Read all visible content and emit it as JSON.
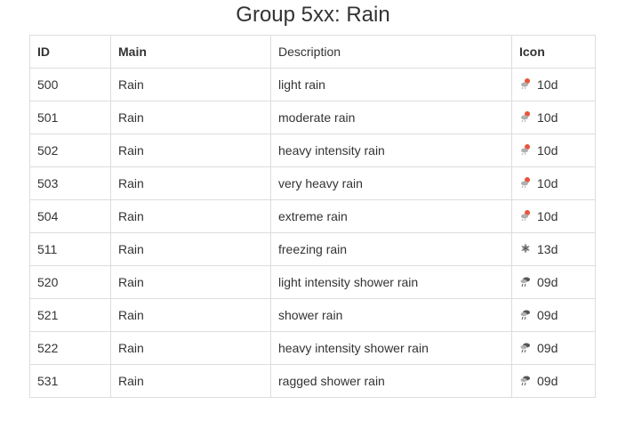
{
  "title": "Group 5xx: Rain",
  "table": {
    "headers": {
      "id": "ID",
      "main": "Main",
      "description": "Description",
      "icon": "Icon"
    },
    "rows": [
      {
        "id": "500",
        "main": "Rain",
        "description": "light rain",
        "icon_code": "10d",
        "icon": "sun-rain-icon"
      },
      {
        "id": "501",
        "main": "Rain",
        "description": "moderate rain",
        "icon_code": "10d",
        "icon": "sun-rain-icon"
      },
      {
        "id": "502",
        "main": "Rain",
        "description": "heavy intensity rain",
        "icon_code": "10d",
        "icon": "sun-rain-icon"
      },
      {
        "id": "503",
        "main": "Rain",
        "description": "very heavy rain",
        "icon_code": "10d",
        "icon": "sun-rain-icon"
      },
      {
        "id": "504",
        "main": "Rain",
        "description": "extreme rain",
        "icon_code": "10d",
        "icon": "sun-rain-icon"
      },
      {
        "id": "511",
        "main": "Rain",
        "description": "freezing rain",
        "icon_code": "13d",
        "icon": "snow-icon"
      },
      {
        "id": "520",
        "main": "Rain",
        "description": "light intensity shower rain",
        "icon_code": "09d",
        "icon": "shower-rain-icon"
      },
      {
        "id": "521",
        "main": "Rain",
        "description": "shower rain",
        "icon_code": "09d",
        "icon": "shower-rain-icon"
      },
      {
        "id": "522",
        "main": "Rain",
        "description": "heavy intensity shower rain",
        "icon_code": "09d",
        "icon": "shower-rain-icon"
      },
      {
        "id": "531",
        "main": "Rain",
        "description": "ragged shower rain",
        "icon_code": "09d",
        "icon": "shower-rain-icon"
      }
    ]
  },
  "colors": {
    "text": "#333333",
    "border": "#dddddd",
    "sun": "#e8553a",
    "cloud": "#b0b0b0",
    "dark_cloud": "#555555"
  }
}
